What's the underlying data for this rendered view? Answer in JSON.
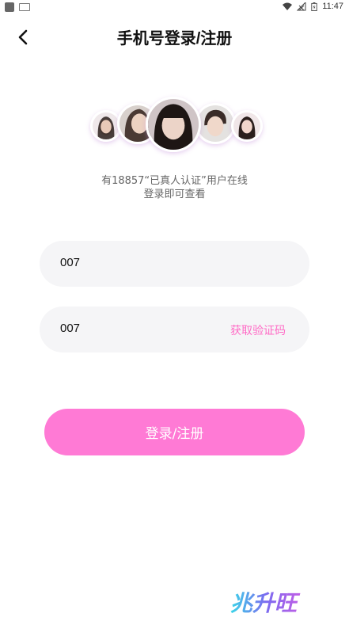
{
  "status_bar": {
    "time": "11:47"
  },
  "header": {
    "title": "手机号登录/注册"
  },
  "online_info": {
    "line1": "有18857“已真人认证”用户在线",
    "line2": "登录即可查看"
  },
  "phone_field": {
    "value": "007"
  },
  "code_field": {
    "value": "007",
    "get_code_label": "获取验证码"
  },
  "login_button": {
    "label": "登录/注册"
  },
  "watermark": {
    "text": "兆升旺"
  },
  "colors": {
    "accent": "#ff7ad5",
    "link": "#ff6bc6",
    "field_bg": "#f5f5f7"
  }
}
